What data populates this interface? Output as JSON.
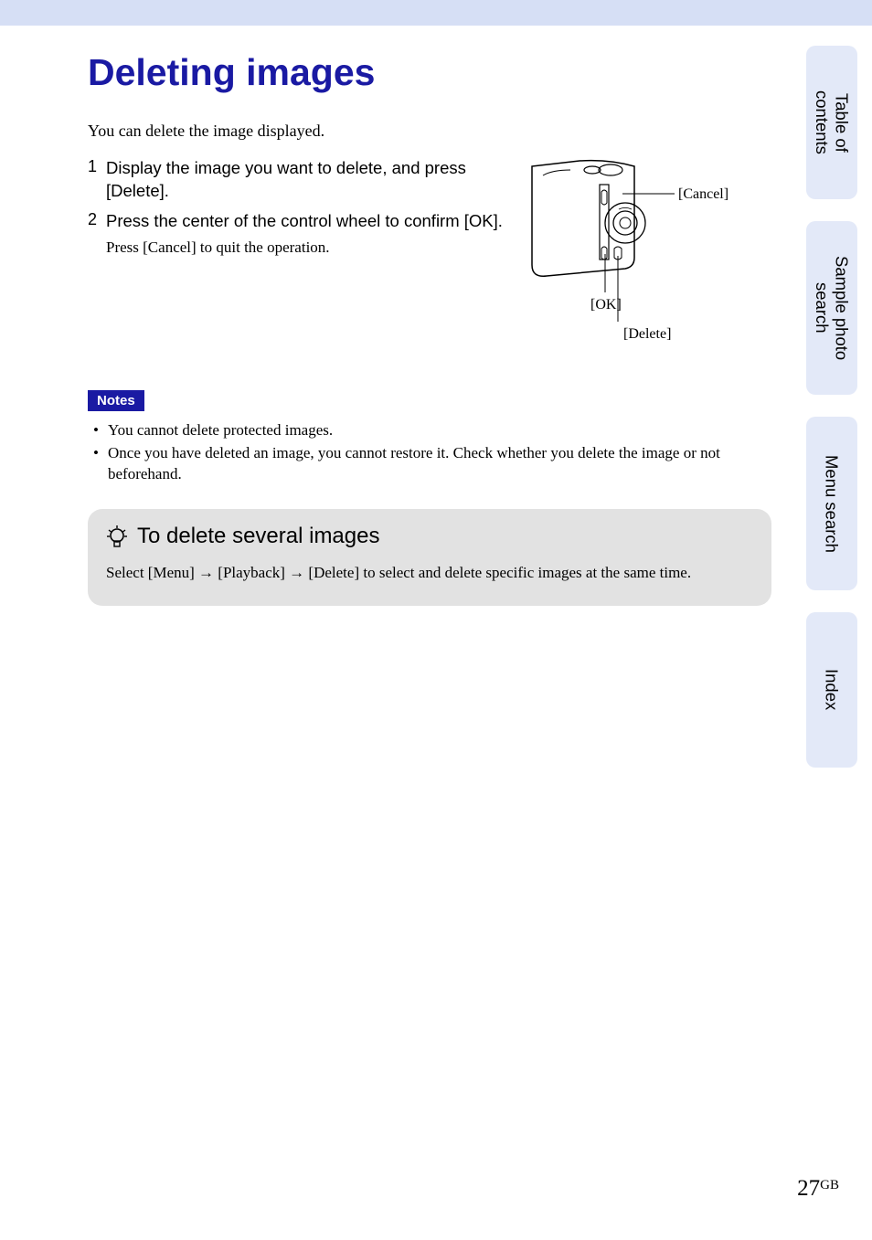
{
  "heading": "Deleting images",
  "intro": "You can delete the image displayed.",
  "steps": [
    {
      "num": "1",
      "title": "Display the image you want to delete, and press [Delete]."
    },
    {
      "num": "2",
      "title": "Press the center of the control wheel to confirm [OK].",
      "sub": "Press [Cancel] to quit the operation."
    }
  ],
  "diagram": {
    "labelCancel": "[Cancel]",
    "labelOK": "[OK]",
    "labelDelete": "[Delete]"
  },
  "notesLabel": "Notes",
  "notes": [
    "You cannot delete protected images.",
    "Once you have deleted an image, you cannot restore it. Check whether you delete the image or not beforehand."
  ],
  "tip": {
    "heading": "To delete several images",
    "body_prefix": "Select [Menu] ",
    "body_mid1": " [Playback] ",
    "body_mid2": " [Delete] to select and delete specific images at the same time."
  },
  "sideTabs": {
    "toc": "Table of contents",
    "sample": "Sample photo search",
    "menu": "Menu search",
    "index": "Index"
  },
  "pageNumber": "27",
  "pageSuffix": "GB"
}
